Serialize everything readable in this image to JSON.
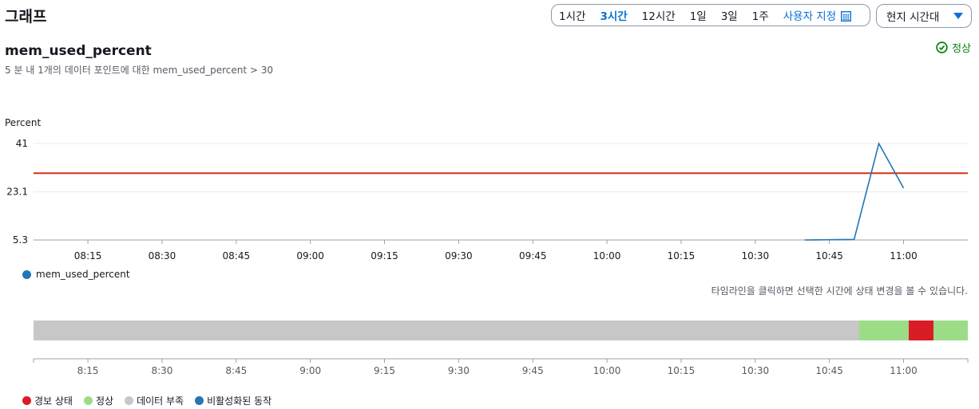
{
  "page": {
    "title": "그래프"
  },
  "time_range": {
    "options": [
      "1시간",
      "3시간",
      "12시간",
      "1일",
      "3일",
      "1주"
    ],
    "active": "3시간",
    "custom_label": "사용자 지정"
  },
  "timezone": {
    "selected": "현지 시간대"
  },
  "alarm": {
    "metric_name": "mem_used_percent",
    "description": "5 분 내 1개의 데이터 포인트에 대한 mem_used_percent > 30",
    "status": "정상"
  },
  "chart_data": {
    "type": "line",
    "ylabel": "Percent",
    "y_ticks": [
      "41",
      "23.1",
      "5.3"
    ],
    "ylim": [
      5.3,
      41
    ],
    "x_ticks": [
      "08:15",
      "08:30",
      "08:45",
      "09:00",
      "09:15",
      "09:30",
      "09:45",
      "10:00",
      "10:15",
      "10:30",
      "10:45",
      "11:00"
    ],
    "xlim": [
      "08:04",
      "11:13"
    ],
    "threshold": 30,
    "threshold_color": "#d13212",
    "series": [
      {
        "name": "mem_used_percent",
        "color": "#1f77b4",
        "points": [
          {
            "time": "10:40",
            "value": 5.3
          },
          {
            "time": "10:50",
            "value": 5.5
          },
          {
            "time": "10:55",
            "value": 41
          },
          {
            "time": "11:00",
            "value": 24.5
          }
        ]
      }
    ],
    "grid": true
  },
  "timeline": {
    "hint": "타임라인을 클릭하면 선택한 시간에 상태 변경을 볼 수 있습니다.",
    "x_ticks": [
      "8:15",
      "8:30",
      "8:45",
      "9:00",
      "9:15",
      "9:30",
      "9:45",
      "10:00",
      "10:15",
      "10:30",
      "10:45",
      "11:00"
    ],
    "segments": [
      {
        "state": "insufficient",
        "start": "08:04",
        "end": "10:51"
      },
      {
        "state": "ok",
        "start": "10:51",
        "end": "11:01"
      },
      {
        "state": "alarm",
        "start": "11:01",
        "end": "11:06"
      },
      {
        "state": "ok",
        "start": "11:06",
        "end": "11:13"
      }
    ]
  },
  "state_legend": [
    {
      "key": "alarm",
      "label": "경보 상태",
      "color": "#d91c26"
    },
    {
      "key": "ok",
      "label": "정상",
      "color": "#9ddc87"
    },
    {
      "key": "insufficient",
      "label": "데이터 부족",
      "color": "#c7c7c7"
    },
    {
      "key": "disabled",
      "label": "비활성화된 동작",
      "color": "#2a74b0"
    }
  ],
  "icons": {
    "calendar": "calendar-icon",
    "status": "check-circle-icon",
    "dropdown": "caret-down-icon"
  }
}
